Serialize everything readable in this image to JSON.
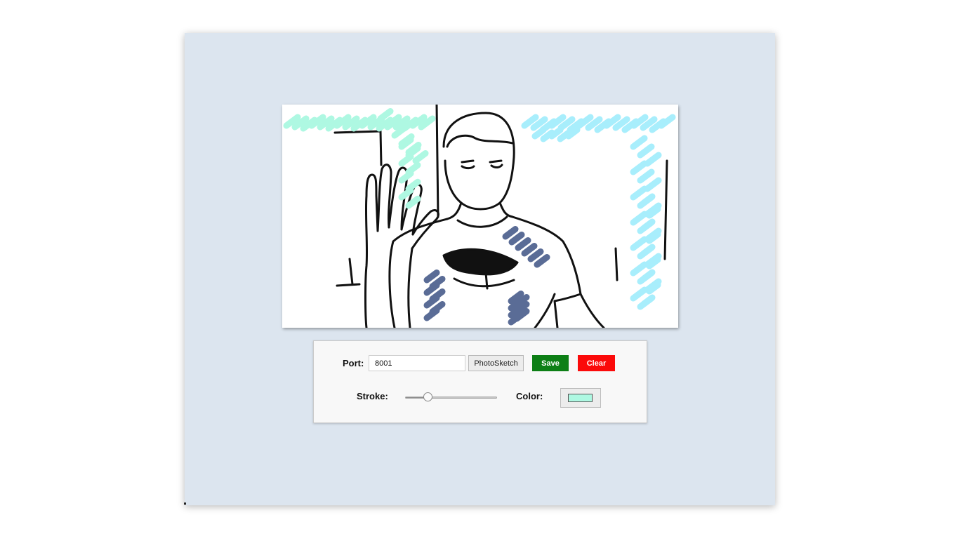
{
  "controls": {
    "port_label": "Port:",
    "port_value": "8001",
    "photosketch_label": "PhotoSketch",
    "save_label": "Save",
    "clear_label": "Clear",
    "stroke_label": "Stroke:",
    "stroke_level": 0.22,
    "color_label": "Color:",
    "current_color": "#aef8e2"
  },
  "colors": {
    "save": "#0d7f16",
    "clear": "#fb0a0a",
    "stroke_mint": "#aef8e2",
    "stroke_cyan": "#a8eefc",
    "stroke_slate": "#5a6c96",
    "window_bg": "#dce5ef"
  }
}
